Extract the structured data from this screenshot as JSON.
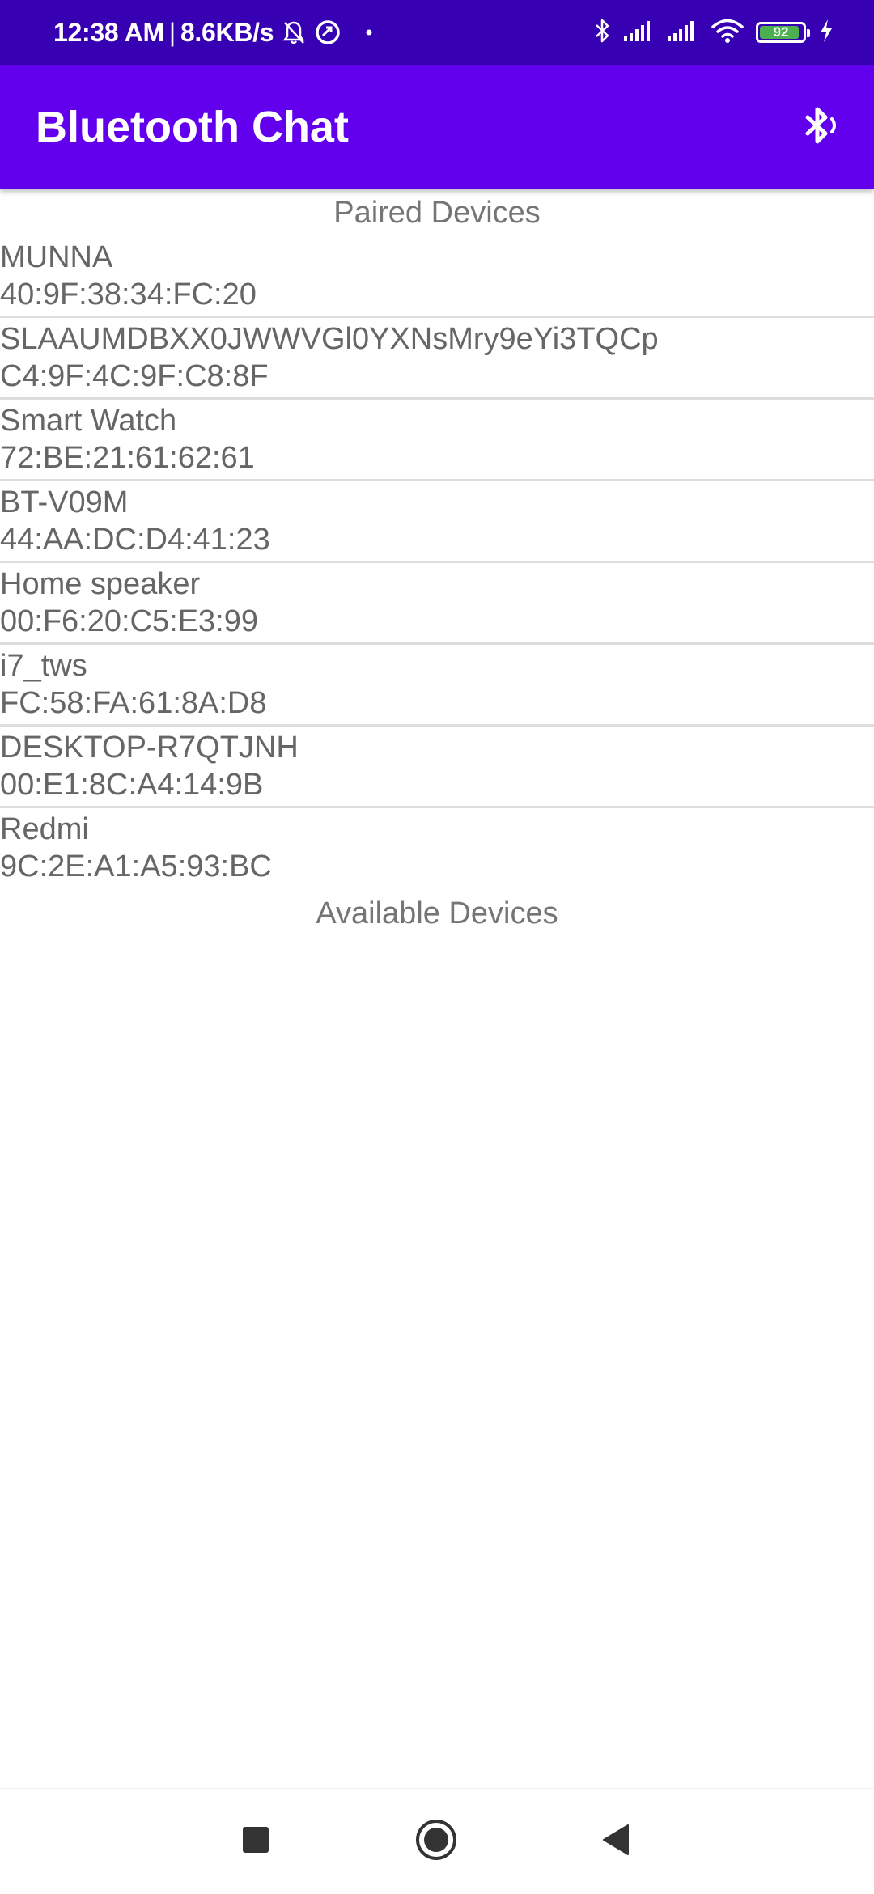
{
  "status_bar": {
    "time": "12:38 AM",
    "separator": "|",
    "net_speed": "8.6KB/s",
    "battery": "92",
    "battery_level": 0.92,
    "icons_left": [
      "bell-off-icon",
      "data-saver-icon",
      "dot-icon"
    ],
    "icons_right": [
      "bluetooth-icon",
      "signal-icon",
      "signal-icon",
      "wifi-icon",
      "battery-icon",
      "charging-bolt-icon"
    ]
  },
  "app_bar": {
    "title": "Bluetooth Chat",
    "action_icon": "bluetooth-discoverable-icon"
  },
  "paired": {
    "header": "Paired Devices",
    "devices": [
      {
        "name": "MUNNA",
        "address": "40:9F:38:34:FC:20"
      },
      {
        "name": "SLAAUMDBXX0JWWVGl0YXNsMry9eYi3TQCp",
        "address": "C4:9F:4C:9F:C8:8F"
      },
      {
        "name": "Smart Watch",
        "address": "72:BE:21:61:62:61"
      },
      {
        "name": "BT-V09M",
        "address": "44:AA:DC:D4:41:23"
      },
      {
        "name": "Home speaker",
        "address": "00:F6:20:C5:E3:99"
      },
      {
        "name": "i7_tws",
        "address": "FC:58:FA:61:8A:D8"
      },
      {
        "name": "DESKTOP-R7QTJNH",
        "address": "00:E1:8C:A4:14:9B"
      },
      {
        "name": "Redmi",
        "address": "9C:2E:A1:A5:93:BC"
      }
    ]
  },
  "available": {
    "header": "Available Devices"
  },
  "nav_bar": {
    "icons": [
      "recent-apps-square-icon",
      "home-circle-icon",
      "back-triangle-icon"
    ]
  },
  "colors": {
    "status_bar": "#3700b3",
    "app_bar": "#6200ee",
    "text_secondary": "#666666",
    "divider": "#dddddd",
    "battery_fill": "#4caf50"
  }
}
